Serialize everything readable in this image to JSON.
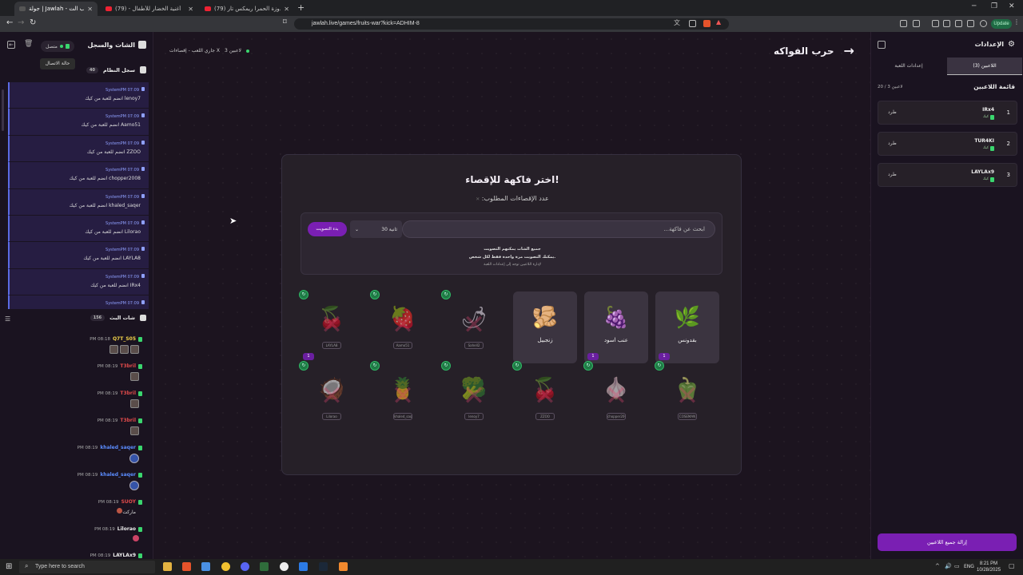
{
  "browser": {
    "tabs": [
      {
        "label": "جولة | Jawlah - منصة الألعاب الت...",
        "active": true
      },
      {
        "label": "أغنية الخضار للأطفال - (79)",
        "active": false
      },
      {
        "label": "(79) انا الدودوزة الحمرا ريمكس تار...",
        "active": false
      }
    ],
    "url": "jawlah.live/games/fruits-war?kick=ADHIM-8",
    "update_label": "Update"
  },
  "left_panel": {
    "title": "الشات والسجل",
    "connection_label": "متصل",
    "connection_tooltip": "حالة الاتصال",
    "system_log_title": "سجل النظام",
    "system_log_badge": "40",
    "system_label": "System",
    "log_items": [
      {
        "time": "PM 07:09",
        "text": "lenoy7 انضم للعبة من كيك"
      },
      {
        "time": "PM 07:09",
        "text": "Aamo51 انضم للعبة من كيك"
      },
      {
        "time": "PM 07:09",
        "text": "ZZOO انضم للعبة من كيك"
      },
      {
        "time": "PM 07:09",
        "text": "chopper2008 انضم للعبة من كيك"
      },
      {
        "time": "PM 07:09",
        "text": "khaled_saqer انضم للعبة من كيك"
      },
      {
        "time": "PM 07:09",
        "text": "Lilorao انضم للعبة من كيك"
      },
      {
        "time": "PM 07:09",
        "text": "LAYLA8 انضم للعبة من كيك"
      },
      {
        "time": "PM 07:09",
        "text": "IRx4 انضم للعبة من كيك"
      },
      {
        "time": "PM 07:09",
        "text": ""
      }
    ],
    "live_chat_title": "شات البث",
    "live_chat_badge": "156",
    "chat_items": [
      {
        "time": "PM 08:18",
        "name": "Q7T_S05",
        "color": "#f3d34a",
        "kind": "thumbs"
      },
      {
        "time": "PM 08:19",
        "name": "T3bril",
        "color": "#e24b4b",
        "kind": "thumb"
      },
      {
        "time": "PM 08:19",
        "name": "T3bril",
        "color": "#e24b4b",
        "kind": "thumb"
      },
      {
        "time": "PM 08:19",
        "name": "T3bril",
        "color": "#e24b4b",
        "kind": "thumb"
      },
      {
        "time": "PM 08:19",
        "name": "khaled_saqer",
        "color": "#5b8cff",
        "kind": "avatar"
      },
      {
        "time": "PM 08:19",
        "name": "khaled_saqer",
        "color": "#5b8cff",
        "kind": "avatar"
      },
      {
        "time": "PM 08:19",
        "name": "SUOY",
        "color": "#e24b4b",
        "text": "ماركت"
      },
      {
        "time": "PM 08:19",
        "name": "Lilorao",
        "color": "#eeeeee",
        "kind": "avatar2"
      },
      {
        "time": "PM 08:19",
        "name": "LAYLAx9",
        "color": "#eeeeee",
        "kind": ""
      }
    ]
  },
  "header": {
    "players_status": "3 لاعبين",
    "game_status": "جاري اللعب - إقصاءات X",
    "game_title": "حرب الفواكه"
  },
  "modal": {
    "title": "اختر فاكهة للإقصاء!",
    "subtitle": "عدد الإقصاءات المطلوب:",
    "search_placeholder": "ابحث عن فاكهة...",
    "timer_value": "30 ثانية",
    "start_label": "بدء التصويت",
    "note_line1": "جميع الشات يمكنهم التصويت",
    "note_line2": "يمكنك التصويت مرة واحدة فقط لكل شخص.",
    "note_line3": "لإدارة اللاعبين توجه إلى إعدادات اللعبة",
    "row1": [
      {
        "label": "بقدونس",
        "glyph": "🌿",
        "votes": "1",
        "eliminated": false
      },
      {
        "label": "عنب اسود",
        "glyph": "🍇",
        "votes": "1",
        "eliminated": false
      },
      {
        "label": "زنجبيل",
        "glyph": "🫚",
        "votes": "",
        "eliminated": false
      },
      {
        "label": "",
        "glyph": "🌶",
        "player": "Sahell2",
        "eliminated": true
      },
      {
        "label": "",
        "glyph": "🍓",
        "player": "Aamo51",
        "eliminated": true
      },
      {
        "label": "",
        "glyph": "🍒",
        "player": "LAYLA8",
        "votes": "1",
        "eliminated": true
      }
    ],
    "row2": [
      {
        "glyph": "🫑",
        "player": "COSEMAN"
      },
      {
        "glyph": "🧄",
        "player": "chopper2008"
      },
      {
        "glyph": "🍒",
        "player": "ZZOO"
      },
      {
        "glyph": "🥦",
        "player": "lenoy7"
      },
      {
        "glyph": "🍍",
        "player": "khaled_saqer"
      },
      {
        "glyph": "🥥",
        "player": "Lilorao"
      }
    ]
  },
  "right_panel": {
    "title": "الإعدادات",
    "tab_players": "اللاعبين (3)",
    "tab_settings": "إعدادات اللعبة",
    "players_heading": "قائمة اللاعبين",
    "players_count": "20 / 3 لاعبين",
    "kick_label": "طرد",
    "source_label": "كيك",
    "players": [
      {
        "num": "1",
        "name": "IRx4"
      },
      {
        "num": "2",
        "name": "TUR4KI"
      },
      {
        "num": "3",
        "name": "LAYLAx9"
      }
    ],
    "remove_all_label": "إزالة جميع اللاعبين"
  },
  "taskbar": {
    "search_placeholder": "Type here to search",
    "language": "ENG",
    "time": "8:21 PM",
    "date": "10/28/2025"
  }
}
